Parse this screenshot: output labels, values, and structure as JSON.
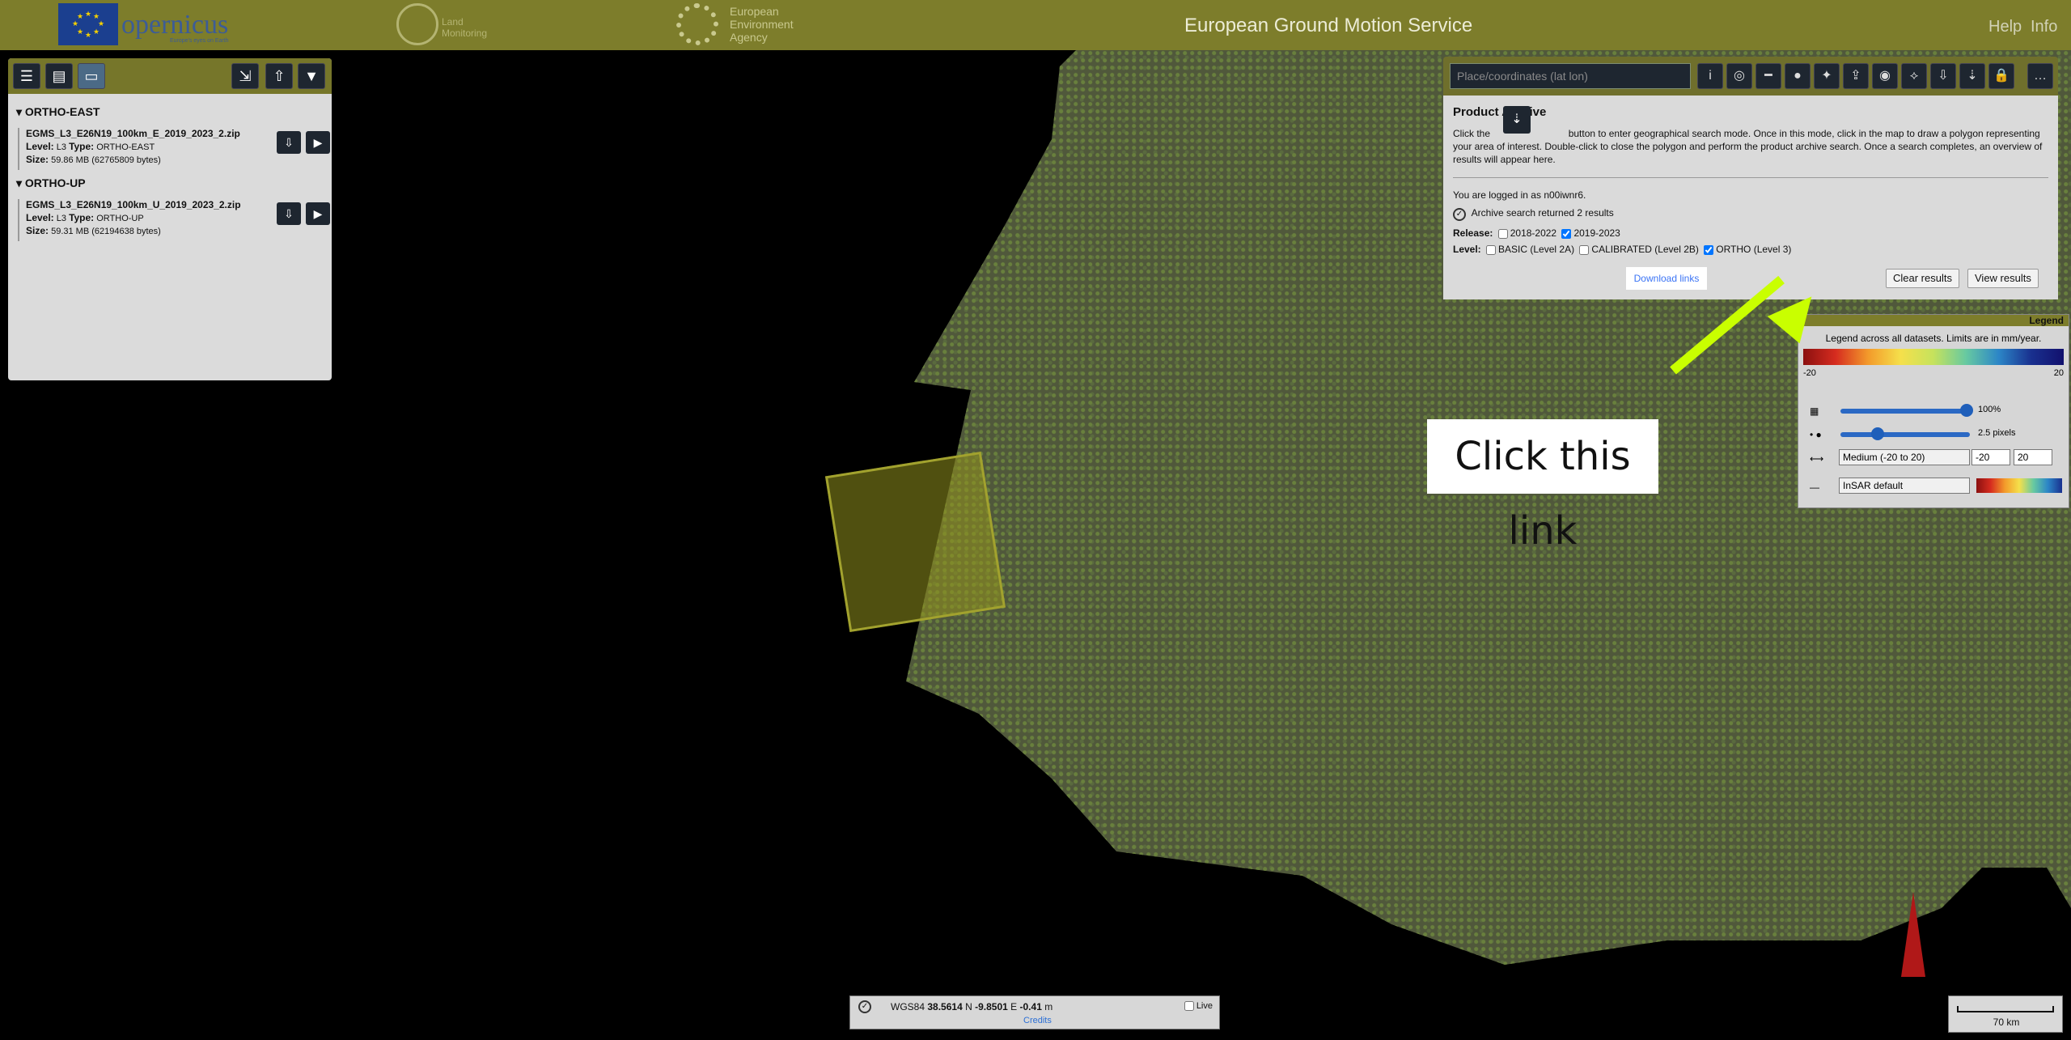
{
  "header": {
    "title": "European Ground Motion Service",
    "copernicus": "opernicus",
    "copernicus_sub": "Europe's eyes on Earth",
    "land_monitoring_line1": "Land",
    "land_monitoring_line2": "Monitoring",
    "eea_line1": "European",
    "eea_line2": "Environment",
    "eea_line3": "Agency",
    "help": "Help",
    "info": "Info"
  },
  "left_panel": {
    "groups": [
      {
        "title": "ORTHO-EAST",
        "file_name": "EGMS_L3_E26N19_100km_E_2019_2023_2.zip",
        "level_label": "Level:",
        "level": "L3",
        "type_label": "Type:",
        "type": "ORTHO-EAST",
        "size_label": "Size:",
        "size": "59.86 MB (62765809 bytes)"
      },
      {
        "title": "ORTHO-UP",
        "file_name": "EGMS_L3_E26N19_100km_U_2019_2023_2.zip",
        "level_label": "Level:",
        "level": "L3",
        "type_label": "Type:",
        "type": "ORTHO-UP",
        "size_label": "Size:",
        "size": "59.31 MB (62194638 bytes)"
      }
    ]
  },
  "top_toolbar": {
    "search_placeholder": "Place/coordinates (lat lon)"
  },
  "archive_panel": {
    "title": "Product Archive",
    "instruction_before": "Click the",
    "instruction_after": "button to enter geographical search mode. Once in this mode, click in the map to draw a polygon representing your area of interest. Double-click to close the polygon and perform the product archive search. Once a search completes, an overview of results will appear here.",
    "login_text": "You are logged in as n00iwnr6.",
    "result_text": "Archive search returned 2 results",
    "release_label": "Release:",
    "release_2018": "2018-2022",
    "release_2019": "2019-2023",
    "level_label": "Level:",
    "level_basic": "BASIC (Level 2A)",
    "level_calibrated": "CALIBRATED (Level 2B)",
    "level_ortho": "ORTHO (Level 3)",
    "download_links": "Download links",
    "clear_results": "Clear results",
    "view_results": "View results"
  },
  "legend": {
    "title": "Legend",
    "description": "Legend across all datasets. Limits are in mm/year.",
    "min": "-20",
    "max": "20",
    "opacity": "100%",
    "point_size": "2.5 pixels",
    "range_select": "Medium (-20 to 20)",
    "range_min": "-20",
    "range_max": "20",
    "palette_select": "InSAR default"
  },
  "callout": {
    "text": "Click this link"
  },
  "status": {
    "crs": "WGS84",
    "lat": "38.5614",
    "lat_dir": "N",
    "lon": "-9.8501",
    "lon_dir": "E",
    "elev": "-0.41",
    "unit": "m",
    "credits": "Credits",
    "live": "Live"
  },
  "map": {
    "scale": "70 km"
  }
}
